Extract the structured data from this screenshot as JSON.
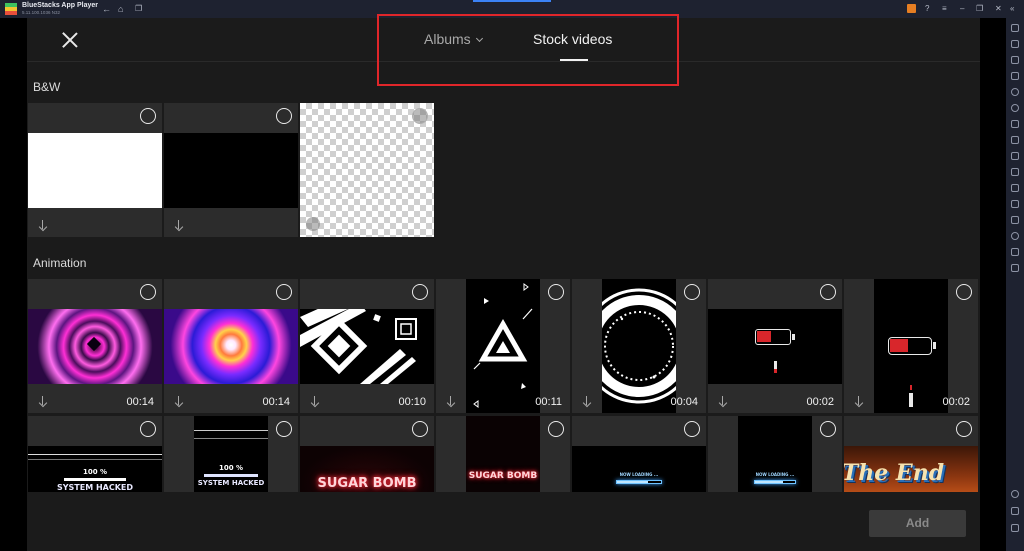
{
  "window": {
    "title": "BlueStacks App Player",
    "subtitle": "5.11.100.1036  N32"
  },
  "header": {
    "tabs": [
      {
        "label": "Albums",
        "active": false
      },
      {
        "label": "Stock videos",
        "active": true
      }
    ]
  },
  "sections": [
    {
      "label": "B&W",
      "items": [
        {
          "kind": "white",
          "duration": ""
        },
        {
          "kind": "black",
          "duration": ""
        },
        {
          "kind": "transparent",
          "duration": ""
        }
      ]
    },
    {
      "label": "Animation",
      "items": [
        {
          "kind": "neon-heart-pink",
          "duration": "00:14"
        },
        {
          "kind": "neon-heart-rainbow",
          "duration": "00:14"
        },
        {
          "kind": "geometric-diamond",
          "duration": "00:10"
        },
        {
          "kind": "triangle",
          "duration": "00:11"
        },
        {
          "kind": "circle-ring",
          "duration": "00:04"
        },
        {
          "kind": "low-battery",
          "duration": "00:02"
        },
        {
          "kind": "low-battery-vertical",
          "duration": "00:02"
        }
      ]
    },
    {
      "label": "",
      "items": [
        {
          "kind": "system-hacked",
          "text": "100 %",
          "text2": "SYSTEM HACKED"
        },
        {
          "kind": "system-hacked-vertical",
          "text": "100 %",
          "text2": "SYSTEM HACKED"
        },
        {
          "kind": "sugar-bomb",
          "text": "SUGAR BOMB"
        },
        {
          "kind": "sugar-bomb-vertical",
          "text": "SUGAR BOMB"
        },
        {
          "kind": "loading",
          "text": "NOW LOADING ..."
        },
        {
          "kind": "loading-vertical",
          "text": "NOW LOADING ..."
        },
        {
          "kind": "the-end",
          "text": "The End"
        }
      ]
    }
  ],
  "footer": {
    "add_label": "Add"
  },
  "colors": {
    "highlight": "#e0262a",
    "neon_pink": "#ff2fd6",
    "battery_red": "#d8262b"
  }
}
